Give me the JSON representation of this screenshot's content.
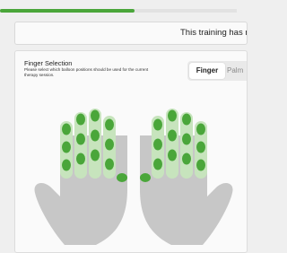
{
  "progress": {
    "fraction": 0.57,
    "color": "#4aa63a"
  },
  "notice": {
    "text": "This training has n"
  },
  "finger_selection": {
    "title": "Finger Selection",
    "description": "Please select which balloon positions should be used for the current therapy session.",
    "tabs": [
      {
        "label": "Finger",
        "selected": true
      },
      {
        "label": "Palm",
        "selected": false
      }
    ]
  },
  "colors": {
    "hand": "#c7c7c7",
    "finger_track": "#c7e4bd",
    "balloon": "#4aa63a",
    "accent": "#4aa63a"
  },
  "hands": [
    {
      "side": "left",
      "fingers": [
        {
          "name": "little",
          "balloons": 3
        },
        {
          "name": "ring",
          "balloons": 3
        },
        {
          "name": "middle",
          "balloons": 3
        },
        {
          "name": "index",
          "balloons": 3
        }
      ],
      "thumb_balloons": 1
    },
    {
      "side": "right",
      "fingers": [
        {
          "name": "index",
          "balloons": 3
        },
        {
          "name": "middle",
          "balloons": 3
        },
        {
          "name": "ring",
          "balloons": 3
        },
        {
          "name": "little",
          "balloons": 3
        }
      ],
      "thumb_balloons": 1
    }
  ]
}
